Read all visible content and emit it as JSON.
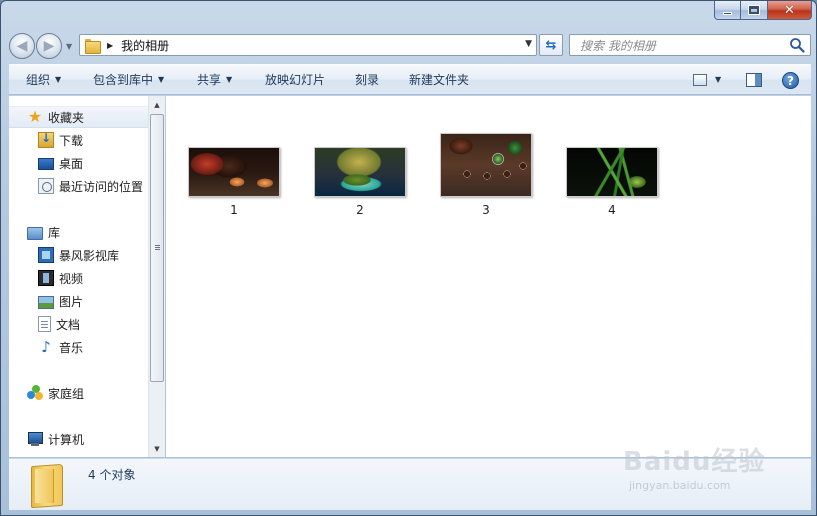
{
  "window": {
    "buttons": {
      "minimize": "minimize",
      "maximize": "maximize",
      "close": "✕"
    }
  },
  "address_bar": {
    "path": "我的相册"
  },
  "search": {
    "placeholder": "搜索 我的相册"
  },
  "toolbar": {
    "items": [
      {
        "label": "组织",
        "has_dropdown": true
      },
      {
        "label": "包含到库中",
        "has_dropdown": true
      },
      {
        "label": "共享",
        "has_dropdown": true
      },
      {
        "label": "放映幻灯片",
        "has_dropdown": false
      },
      {
        "label": "刻录",
        "has_dropdown": false
      },
      {
        "label": "新建文件夹",
        "has_dropdown": false
      }
    ],
    "help_label": "?"
  },
  "sidebar": {
    "favorites": {
      "label": "收藏夹",
      "items": [
        {
          "label": "下载",
          "icon": "download-folder-icon"
        },
        {
          "label": "桌面",
          "icon": "desktop-icon"
        },
        {
          "label": "最近访问的位置",
          "icon": "recent-places-icon"
        }
      ]
    },
    "libraries": {
      "label": "库",
      "items": [
        {
          "label": "暴风影视库",
          "icon": "video-library-icon"
        },
        {
          "label": "视频",
          "icon": "film-icon"
        },
        {
          "label": "图片",
          "icon": "picture-icon"
        },
        {
          "label": "文档",
          "icon": "document-icon"
        },
        {
          "label": "音乐",
          "icon": "music-note-icon"
        }
      ]
    },
    "homegroup": {
      "label": "家庭组"
    },
    "computer": {
      "label": "计算机"
    }
  },
  "files": [
    {
      "name": "1",
      "thumbnail": "tea-cups-red-cloth"
    },
    {
      "name": "2",
      "thumbnail": "tea-leaves-celadon-dish"
    },
    {
      "name": "3",
      "thumbnail": "tea-set-tray-top-view"
    },
    {
      "name": "4",
      "thumbnail": "orchid-leaves-dark"
    }
  ],
  "details": {
    "count": "4 个对象"
  },
  "watermark": {
    "logo": "Baidu经验",
    "url": "jingyan.baidu.com"
  }
}
